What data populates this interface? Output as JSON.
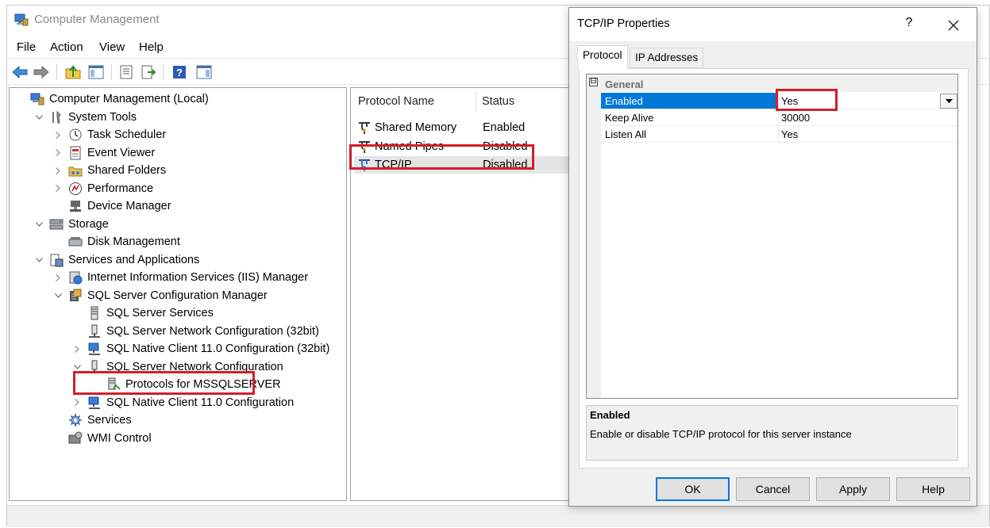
{
  "main_window": {
    "title": "Computer Management",
    "menu": [
      "File",
      "Action",
      "View",
      "Help"
    ]
  },
  "toolbar": {
    "icons": [
      "back-arrow-icon",
      "forward-arrow-icon",
      "up-folder-icon",
      "show-hide-tree-icon",
      "properties-icon",
      "export-list-icon",
      "help-icon",
      "show-action-pane-icon"
    ]
  },
  "tree": {
    "items": [
      {
        "label": "Computer Management (Local)",
        "level": 0,
        "chevron": "none",
        "icon": "computer-management-icon"
      },
      {
        "label": "System Tools",
        "level": 1,
        "chevron": "expanded",
        "icon": "tools-icon"
      },
      {
        "label": "Task Scheduler",
        "level": 2,
        "chevron": "collapsed",
        "icon": "clock-icon"
      },
      {
        "label": "Event Viewer",
        "level": 2,
        "chevron": "collapsed",
        "icon": "event-viewer-icon"
      },
      {
        "label": "Shared Folders",
        "level": 2,
        "chevron": "collapsed",
        "icon": "shared-folders-icon"
      },
      {
        "label": "Performance",
        "level": 2,
        "chevron": "collapsed",
        "icon": "performance-icon"
      },
      {
        "label": "Device Manager",
        "level": 2,
        "chevron": "none",
        "icon": "device-manager-icon"
      },
      {
        "label": "Storage",
        "level": 1,
        "chevron": "expanded",
        "icon": "storage-icon"
      },
      {
        "label": "Disk Management",
        "level": 2,
        "chevron": "none",
        "icon": "disk-icon"
      },
      {
        "label": "Services and Applications",
        "level": 1,
        "chevron": "expanded",
        "icon": "services-apps-icon"
      },
      {
        "label": "Internet Information Services (IIS) Manager",
        "level": 2,
        "chevron": "collapsed",
        "icon": "iis-icon"
      },
      {
        "label": "SQL Server Configuration Manager",
        "level": 2,
        "chevron": "expanded",
        "icon": "sql-config-icon"
      },
      {
        "label": "SQL Server Services",
        "level": 3,
        "chevron": "none",
        "icon": "server-icon"
      },
      {
        "label": "SQL Server Network Configuration (32bit)",
        "level": 3,
        "chevron": "none",
        "icon": "network-config-icon"
      },
      {
        "label": "SQL Native Client 11.0 Configuration (32bit)",
        "level": 3,
        "chevron": "collapsed",
        "icon": "native-client-icon"
      },
      {
        "label": "SQL Server Network Configuration",
        "level": 3,
        "chevron": "expanded",
        "icon": "network-config-icon"
      },
      {
        "label": "Protocols for MSSQLSERVER",
        "level": 4,
        "chevron": "none",
        "icon": "protocols-icon"
      },
      {
        "label": "SQL Native Client 11.0 Configuration",
        "level": 3,
        "chevron": "collapsed",
        "icon": "native-client-icon"
      },
      {
        "label": "Services",
        "level": 2,
        "chevron": "none",
        "icon": "services-gear-icon"
      },
      {
        "label": "WMI Control",
        "level": 2,
        "chevron": "none",
        "icon": "wmi-icon"
      }
    ]
  },
  "list": {
    "columns": [
      "Protocol Name",
      "Status"
    ],
    "rows": [
      {
        "name": "Shared Memory",
        "status": "Enabled"
      },
      {
        "name": "Named Pipes",
        "status": "Disabled"
      },
      {
        "name": "TCP/IP",
        "status": "Disabled"
      }
    ]
  },
  "dialog": {
    "title": "TCP/IP Properties",
    "help_glyph": "?",
    "tabs": [
      "Protocol",
      "IP Addresses"
    ],
    "category_toggle": "⊟",
    "category": "General",
    "properties": [
      {
        "name": "Enabled",
        "value": "Yes"
      },
      {
        "name": "Keep Alive",
        "value": "30000"
      },
      {
        "name": "Listen All",
        "value": "Yes"
      }
    ],
    "description_title": "Enabled",
    "description_text": "Enable or disable TCP/IP protocol for this server instance",
    "buttons": {
      "ok": "OK",
      "cancel": "Cancel",
      "apply": "Apply",
      "help": "Help"
    }
  },
  "colors": {
    "highlight": "#d0202a",
    "selection": "#0078d7",
    "dialog_bg": "#f0f0f0"
  }
}
